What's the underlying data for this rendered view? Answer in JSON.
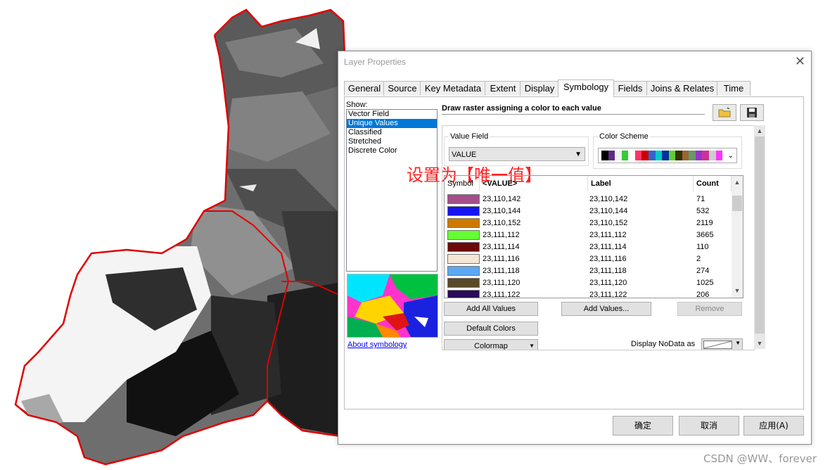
{
  "dialog": {
    "title": "Layer Properties",
    "tabs": [
      "General",
      "Source",
      "Key Metadata",
      "Extent",
      "Display",
      "Symbology",
      "Fields",
      "Joins & Relates",
      "Time"
    ],
    "active_tab": "Symbology",
    "show_label": "Show:",
    "show_items": [
      "Vector Field",
      "Unique Values",
      "Classified",
      "Stretched",
      "Discrete Color"
    ],
    "selected_show": "Unique Values",
    "about_link": "About symbology",
    "description": "Draw raster assigning a color to each value",
    "annotation": "设置为【唯一值】",
    "value_field_label": "Value Field",
    "value_field": "VALUE",
    "color_scheme_label": "Color Scheme",
    "table": {
      "headers": [
        "Symbol",
        "<VALUE>",
        "Label",
        "Count"
      ],
      "rows": [
        {
          "color": "#a64d8c",
          "value": "23,110,142",
          "label": "23,110,142",
          "count": "71"
        },
        {
          "color": "#1414f0",
          "value": "23,110,144",
          "label": "23,110,144",
          "count": "532"
        },
        {
          "color": "#cc7a00",
          "value": "23,110,152",
          "label": "23,110,152",
          "count": "2119"
        },
        {
          "color": "#66ff33",
          "value": "23,111,112",
          "label": "23,111,112",
          "count": "3665"
        },
        {
          "color": "#6b0a0a",
          "value": "23,111,114",
          "label": "23,111,114",
          "count": "110"
        },
        {
          "color": "#f5e6d6",
          "value": "23,111,116",
          "label": "23,111,116",
          "count": "2"
        },
        {
          "color": "#5ca8f2",
          "value": "23,111,118",
          "label": "23,111,118",
          "count": "274"
        },
        {
          "color": "#5a4a28",
          "value": "23,111,120",
          "label": "23,111,120",
          "count": "1025"
        },
        {
          "color": "#2a0a5a",
          "value": "23,111,122",
          "label": "23,111,122",
          "count": "206"
        }
      ]
    },
    "buttons": {
      "add_all": "Add All Values",
      "add_values": "Add Values...",
      "remove": "Remove",
      "default_colors": "Default Colors",
      "colormap": "Colormap"
    },
    "nodata_label": "Display NoData as",
    "ok": "确定",
    "cancel": "取消",
    "apply": "应用(A)"
  },
  "watermark": "CSDN @WW、forever",
  "colors": {
    "accent": "#0078d7",
    "boundary": "#e00000",
    "annotation": "#ff2222",
    "scheme": [
      "#000000",
      "#5a2d82",
      "#f0f0f0",
      "#33cc33",
      "#ffffff",
      "#ff3366",
      "#cc0000",
      "#3366cc",
      "#00cccc",
      "#003399",
      "#66cc33",
      "#333300",
      "#996633",
      "#669966",
      "#9933cc",
      "#cc3399",
      "#cccccc",
      "#ff33ff"
    ]
  }
}
